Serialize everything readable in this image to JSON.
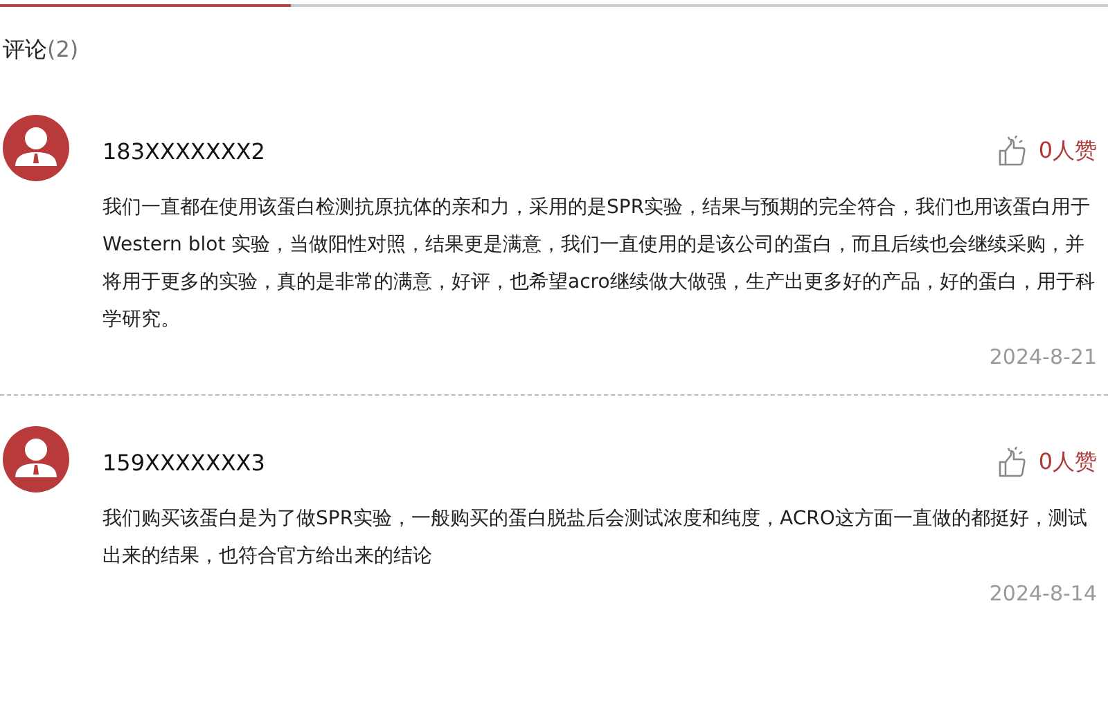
{
  "header": {
    "title": "评论",
    "count": "(2)"
  },
  "comments": [
    {
      "user": "183XXXXXXX2",
      "likes": "0人赞",
      "text": "我们一直都在使用该蛋白检测抗原抗体的亲和力，采用的是SPR实验，结果与预期的完全符合，我们也用该蛋白用于Western blot 实验，当做阳性对照，结果更是满意，我们一直使用的是该公司的蛋白，而且后续也会继续采购，并将用于更多的实验，真的是非常的满意，好评，也希望acro继续做大做强，生产出更多好的产品，好的蛋白，用于科学研究。",
      "date": "2024-8-21"
    },
    {
      "user": "159XXXXXXX3",
      "likes": "0人赞",
      "text": "我们购买该蛋白是为了做SPR实验，一般购买的蛋白脱盐后会测试浓度和纯度，ACRO这方面一直做的都挺好，测试出来的结果，也符合官方给出来的结论",
      "date": "2024-8-14"
    }
  ]
}
